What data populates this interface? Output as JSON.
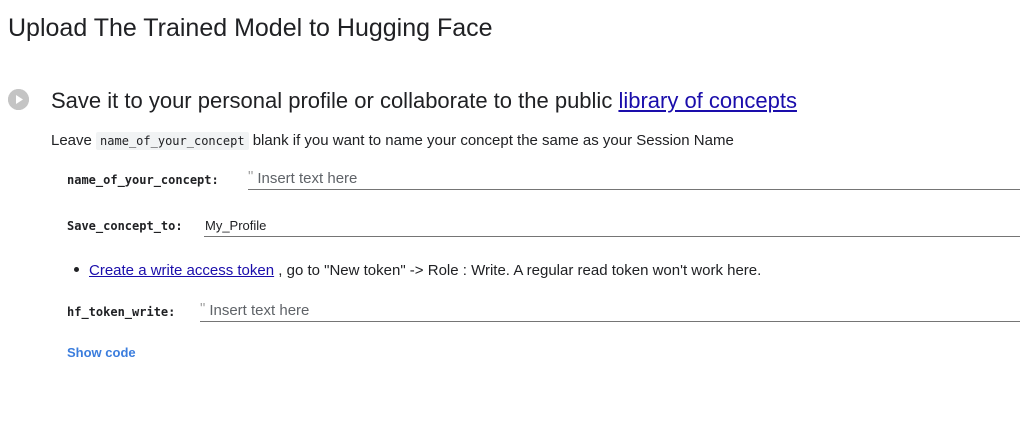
{
  "section": {
    "title": "Upload The Trained Model to Hugging Face"
  },
  "cell": {
    "run_icon": "play-circle-icon",
    "heading_text": "Save it to your personal profile or collaborate to the public ",
    "heading_link": "library of concepts",
    "desc_before": "Leave ",
    "desc_code": "name_of_your_concept",
    "desc_after": " blank if you want to name your concept the same as your Session Name"
  },
  "form": {
    "concept_label": "name_of_your_concept:",
    "concept_quote": "\"",
    "concept_placeholder": "Insert text here",
    "save_label": "Save_concept_to:",
    "save_value": "My_Profile",
    "token_link": "Create a write access token",
    "token_note": " , go to \"New token\" -> Role : Write. A regular read token won't work here.",
    "hf_label": "hf_token_write:",
    "hf_quote": "\"",
    "hf_placeholder": "Insert text here"
  },
  "footer": {
    "show_code": "Show code"
  },
  "colors": {
    "link": "#1a0dab",
    "show_code": "#3b7ddd",
    "run_button": "#c4c4c4"
  }
}
